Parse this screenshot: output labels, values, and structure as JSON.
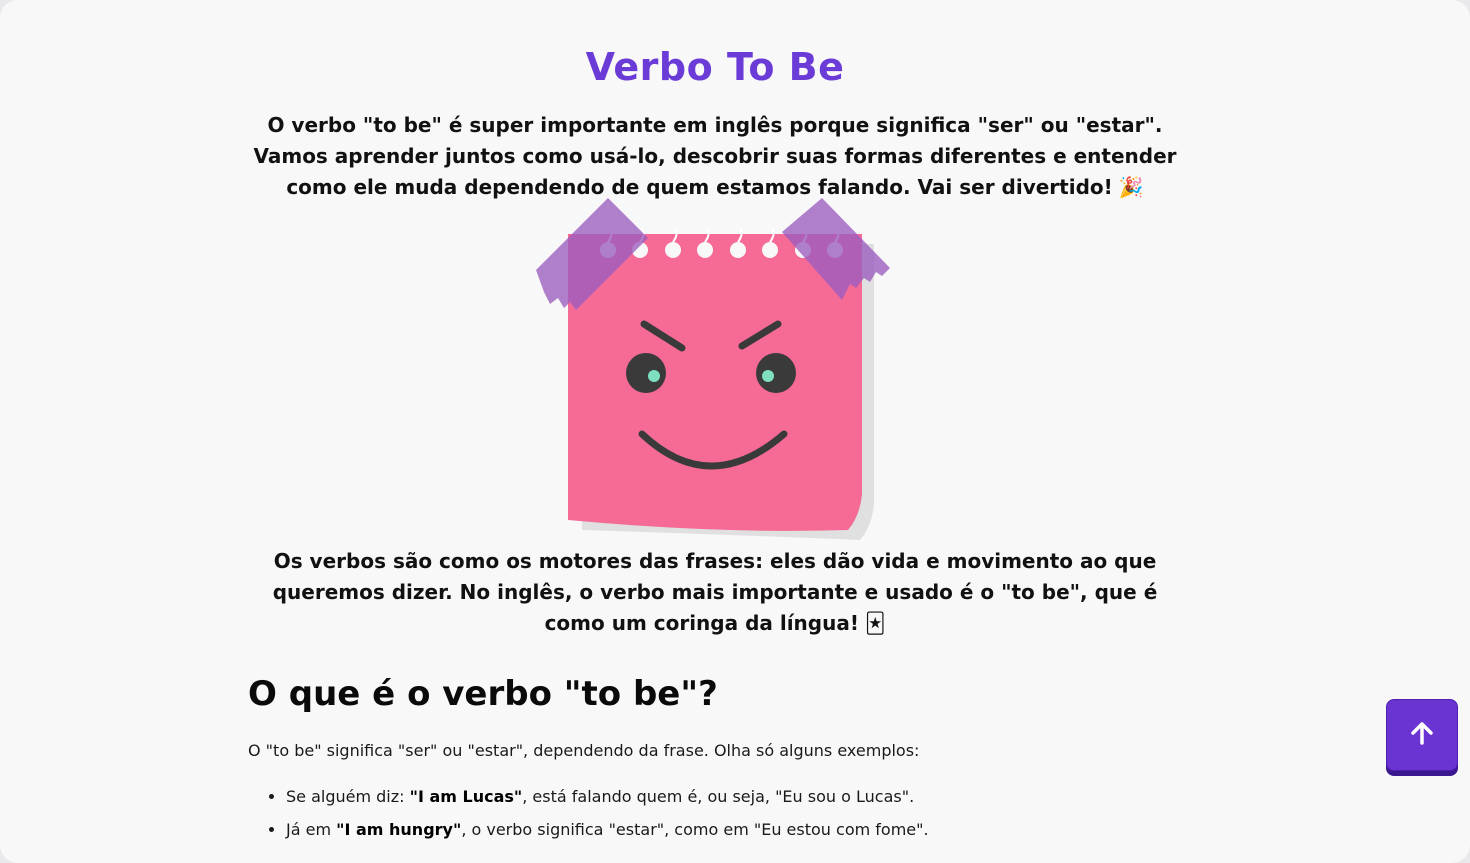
{
  "page": {
    "title": "Verbo To Be",
    "intro_text": "O verbo \"to be\" é super importante em inglês porque significa \"ser\" ou \"estar\". Vamos aprender juntos como usá-lo, descobrir suas formas diferentes e entender como ele muda dependendo de quem estamos falando. Vai ser divertido!",
    "intro_emoji": "🎉",
    "outro_text": "Os verbos são como os motores das frases: eles dão vida e movimento ao que queremos dizer. No inglês, o verbo mais importante e usado é o \"to be\", que é como um coringa da língua!",
    "outro_emoji": "🃏"
  },
  "section": {
    "heading": "O que é o verbo \"to be\"?",
    "paragraph": "O \"to be\" significa \"ser\" ou \"estar\", dependendo da frase. Olha só alguns exemplos:",
    "examples": [
      {
        "prefix": "Se alguém diz: ",
        "bold": "\"I am Lucas\"",
        "suffix": ", está falando quem é, ou seja, \"Eu sou o Lucas\"."
      },
      {
        "prefix": "Já em ",
        "bold": "\"I am hungry\"",
        "suffix": ", o verbo significa \"estar\", como em \"Eu estou com fome\"."
      }
    ]
  },
  "illustration": {
    "icon": "sticky-note-face-icon",
    "note_color": "#f56b96",
    "tape_color": "#9b5cbf",
    "eye_color": "#7ee0c1"
  },
  "controls": {
    "back_to_top_icon": "arrow-up-icon",
    "back_to_top_color": "#6a34d2"
  },
  "colors": {
    "title": "#6a3bd6",
    "background": "#f8f8f8"
  }
}
